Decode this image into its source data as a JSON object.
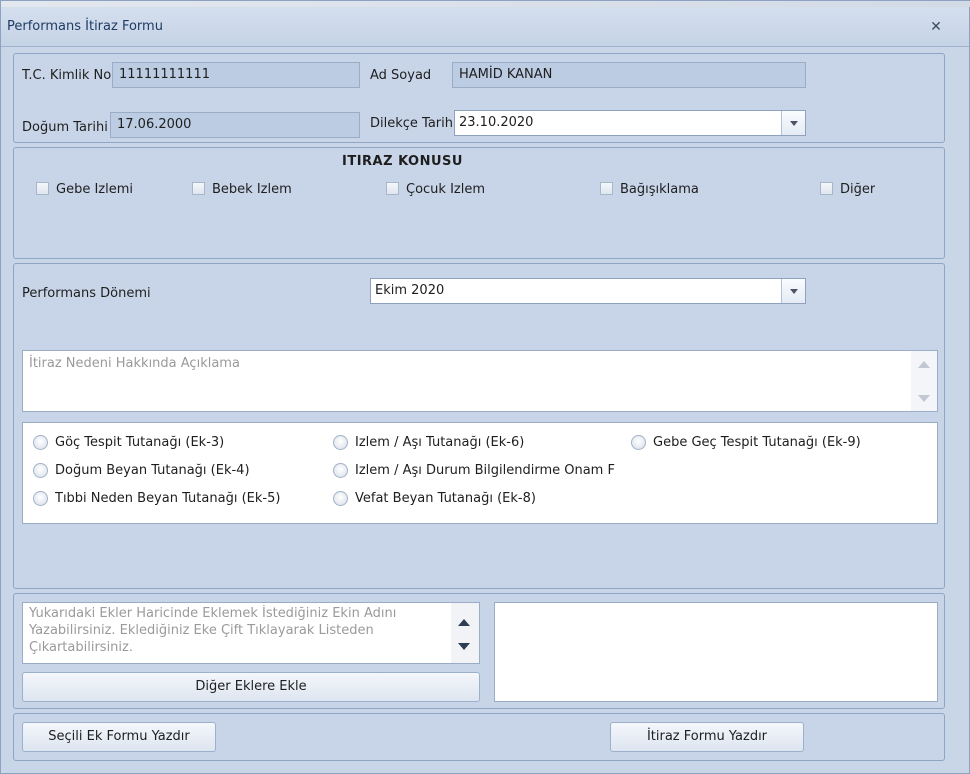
{
  "window": {
    "title": "Performans İtiraz Formu"
  },
  "person": {
    "tc_label": "T.C. Kimlik No",
    "tc_value": "11111111111",
    "name_label": "Ad Soyad",
    "name_value": "HAMİD KANAN",
    "birth_label": "Doğum Tarihi",
    "birth_value": "17.06.2000",
    "petition_label": "Dilekçe Tarihi",
    "petition_value": "23.10.2020"
  },
  "subject": {
    "title": "İTİRAZ KONUSU",
    "options": [
      "Gebe İzlemi",
      "Bebek İzlem",
      "Çocuk İzlem",
      "Bağışıklama",
      "Diğer"
    ]
  },
  "performance": {
    "period_label": "Performans Dönemi",
    "period_value": "Ekim 2020",
    "explanation_placeholder": "İtiraz Nedeni Hakkında Açıklama"
  },
  "attachments": {
    "options": [
      "Göç Tespit Tutanağı (Ek-3)",
      "İzlem / Aşı Tutanağı (Ek-6)",
      "Gebe Geç Tespit Tutanağı (Ek-9)",
      "Doğum Beyan Tutanağı (Ek-4)",
      "İzlem / Aşı Durum Bilgilendirme Onam F",
      "Tıbbi Neden Beyan Tutanağı (Ek-5)",
      "Vefat Beyan Tutanağı (Ek-8)"
    ],
    "other_placeholder": "Yukarıdaki Ekler Haricinde Eklemek İstediğiniz Ekin Adını Yazabilirsiniz. Eklediğiniz Eke Çift Tıklayarak Listeden Çıkartabilirsiniz.",
    "add_button": "Diğer Eklere Ekle"
  },
  "footer": {
    "print_selected": "Seçili Ek Formu Yazdır",
    "print_form": "İtiraz Formu Yazdır"
  }
}
